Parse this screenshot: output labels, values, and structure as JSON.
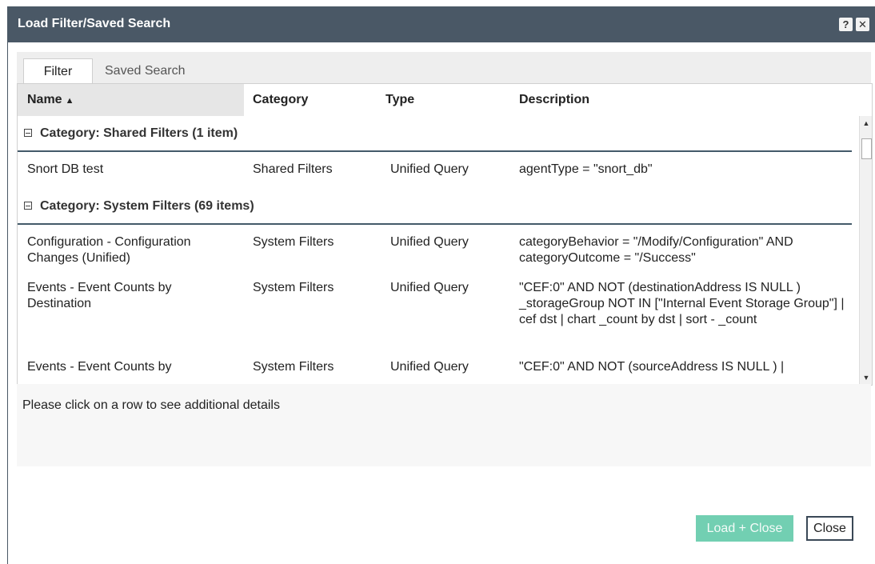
{
  "dialog": {
    "title": "Load Filter/Saved Search",
    "help_icon": "question-icon",
    "close_icon": "close-icon"
  },
  "tabs": [
    {
      "label": "Filter",
      "active": true
    },
    {
      "label": "Saved Search",
      "active": false
    }
  ],
  "grid": {
    "columns": [
      "Name",
      "Category",
      "Type",
      "Description"
    ],
    "sort_column": "Name",
    "sort_direction": "ascending",
    "groups": [
      {
        "label": "Category: Shared Filters (1 item)",
        "rows": [
          {
            "name": "Snort DB test",
            "category": "Shared Filters",
            "type": "Unified Query",
            "description": "agentType = \"snort_db\""
          }
        ]
      },
      {
        "label": "Category: System Filters (69 items)",
        "rows": [
          {
            "name": "Configuration - Configuration Changes (Unified)",
            "category": "System Filters",
            "type": "Unified Query",
            "description": "categoryBehavior = \"/Modify/Configuration\" AND categoryOutcome = \"/Success\""
          },
          {
            "name": "Events - Event Counts by Destination",
            "category": "System Filters",
            "type": "Unified Query",
            "description": "\"CEF:0\" AND NOT (destinationAddress IS NULL ) _storageGroup NOT IN [\"Internal Event Storage Group\"] | cef dst | chart _count by dst | sort - _count"
          },
          {
            "name": "Events - Event Counts by",
            "category": "System Filters",
            "type": "Unified Query",
            "description": "\"CEF:0\" AND NOT (sourceAddress IS NULL ) |"
          }
        ]
      }
    ]
  },
  "details_text": "Please click on a row to see additional details",
  "buttons": {
    "load_close": "Load + Close",
    "close": "Close"
  },
  "colors": {
    "titlebar": "#4a5866",
    "accent_button": "#72cfb2",
    "group_divider": "#445a6a"
  }
}
